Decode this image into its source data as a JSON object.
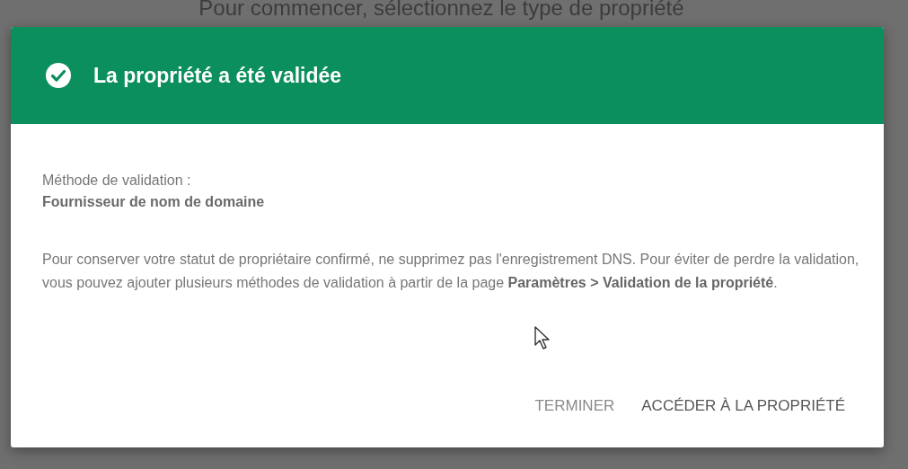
{
  "background": {
    "heading": "Pour commencer, sélectionnez le type de propriété"
  },
  "dialog": {
    "title": "La propriété a été validée",
    "method_label": "Méthode de validation :",
    "method_value": "Fournisseur de nom de domaine",
    "message": "Pour conserver votre statut de propriétaire confirmé, ne supprimez pas l'enregistrement DNS. Pour éviter de perdre la validation, vous pouvez ajouter plusieurs méthodes de validation à partir de la page **Paramètres > Validation de la propriété**.",
    "buttons": [
      {
        "label": "TERMINER",
        "kind": "secondary"
      },
      {
        "label": "ACCÉDER À LA PROPRIÉTÉ",
        "kind": "primary"
      }
    ]
  }
}
